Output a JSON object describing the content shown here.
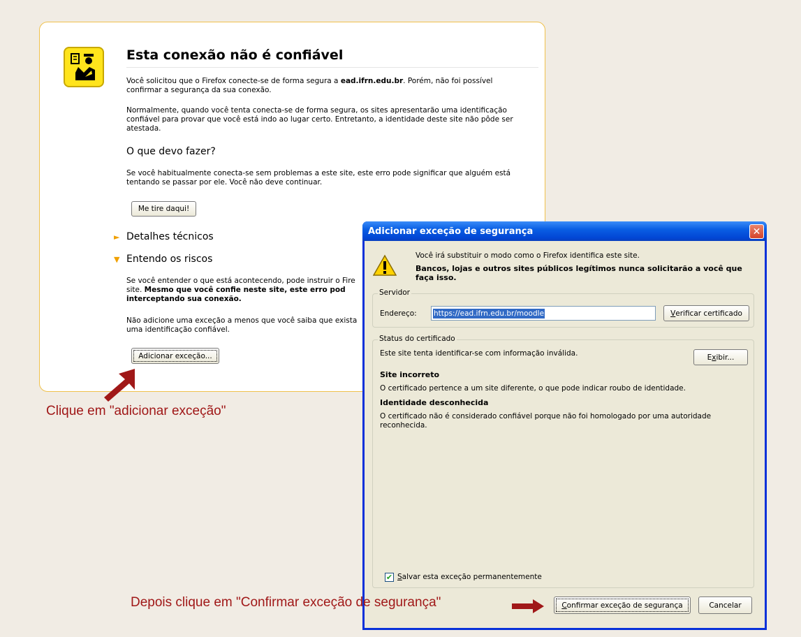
{
  "error_page": {
    "title": "Esta conexão não é confiável",
    "intro_prefix": "Você solicitou que o Firefox conecte-se de forma segura a ",
    "intro_host": "ead.ifrn.edu.br",
    "intro_suffix": ". Porém, não foi possível confirmar a segurança da sua conexão.",
    "normally": "Normalmente, quando você tenta conecta-se de forma segura, os sites apresentarão uma identificação confiável para provar que você está indo ao lugar certo. Entretanto, a identidade deste site não pôde ser atestada.",
    "what_heading": "O que devo fazer?",
    "what_text": "Se você habitualmente conecta-se sem problemas a este site, este erro pode significar que alguém está tentando se passar por ele. Você não deve continuar.",
    "get_me_out_button": "Me tire daqui!",
    "tech_details": "Detalhes técnicos",
    "understand_risks": "Entendo os riscos",
    "risks_text_1": "Se você entender o que está acontecendo, pode instruir o Fire",
    "risks_text_2_plain": "site. ",
    "risks_text_2_bold": "Mesmo que você confie neste site, este erro pod",
    "risks_text_3_bold": "interceptando sua conexão.",
    "no_exception_1": "Não adicione uma exceção a menos que você saiba que exista",
    "no_exception_2": "uma identificação confiável.",
    "add_exception_button": "Adicionar exceção..."
  },
  "annotations": {
    "first": "Clique em \"adicionar exceção\"",
    "second": "Depois clique em \"Confirmar exceção de segurança\""
  },
  "dialog": {
    "title": "Adicionar exceção de segurança",
    "close": "✕",
    "warn_line": "Você irá substituir o modo como o Firefox identifica este site.",
    "warn_bold": "Bancos, lojas e outros sites públicos legítimos nunca solicitarão a você que faça isso.",
    "server_group": "Servidor",
    "address_label": "Endereço:",
    "address_value": "https://ead.ifrn.edu.br/moodle",
    "verify_button_u": "V",
    "verify_button_rest": "erificar certificado",
    "status_group": "Status do certificado",
    "status_text": "Este site tenta identificar-se com informação inválida.",
    "view_button_pre": "E",
    "view_button_u": "x",
    "view_button_rest": "ibir...",
    "wrong_site_heading": "Site incorreto",
    "wrong_site_text": "O certificado pertence a um site diferente, o que pode indicar roubo de identidade.",
    "unknown_heading": "Identidade desconhecida",
    "unknown_text": "O certificado não é considerado confiável porque não foi homologado por uma autoridade reconhecida.",
    "save_permanent_u": "S",
    "save_permanent_rest": "alvar esta exceção permanentemente",
    "save_checked": "✔",
    "confirm_button_u": "C",
    "confirm_button_rest": "onfirmar exceção de segurança",
    "cancel_button": "Cancelar"
  },
  "colors": {
    "annotation": "#a01818",
    "titlebar": "#0a5fe4",
    "warning_yellow": "#ffe41c"
  }
}
